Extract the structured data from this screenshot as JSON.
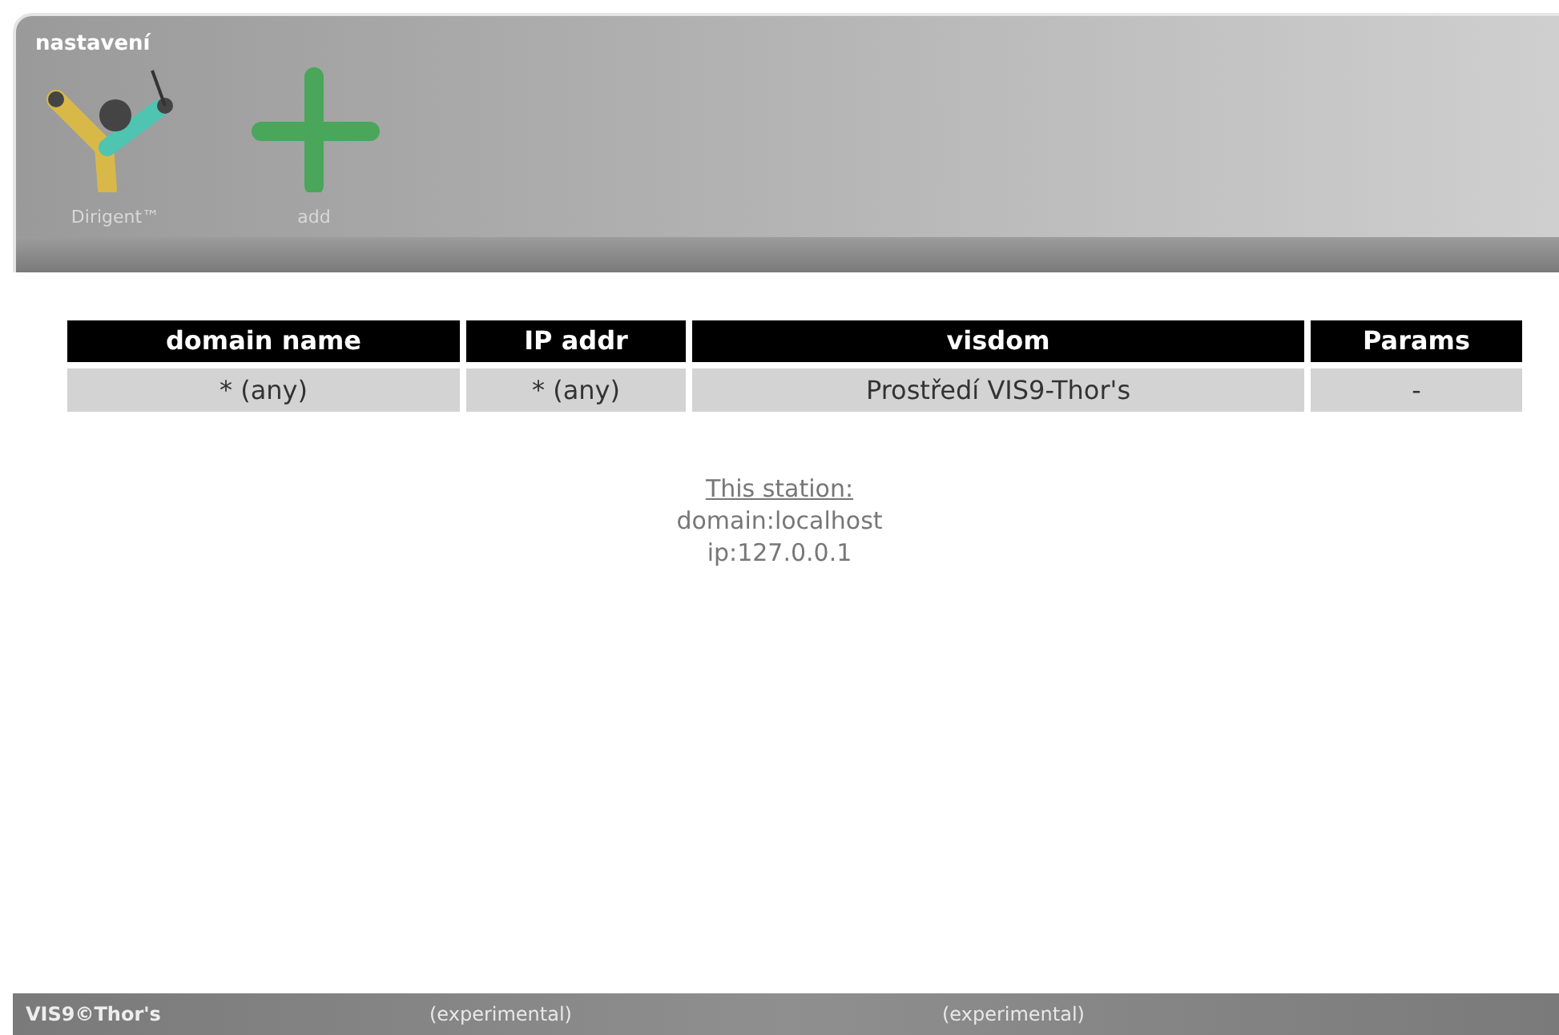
{
  "header": {
    "title": "nastavení",
    "tools": [
      {
        "kind": "dirigent",
        "label": "Dirigent™"
      },
      {
        "kind": "add",
        "label": "add"
      }
    ]
  },
  "table": {
    "columns": [
      "domain name",
      "IP addr",
      "visdom",
      "Params"
    ],
    "rows": [
      [
        "* (any)",
        "* (any)",
        "Prostředí VIS9-Thor's",
        "-"
      ]
    ]
  },
  "station": {
    "heading": "This station:",
    "lines": [
      "domain:localhost",
      "ip:127.0.0.1"
    ]
  },
  "footer": {
    "brand": "VIS9©Thor's",
    "notes": [
      "(experimental)",
      "(experimental)"
    ]
  }
}
